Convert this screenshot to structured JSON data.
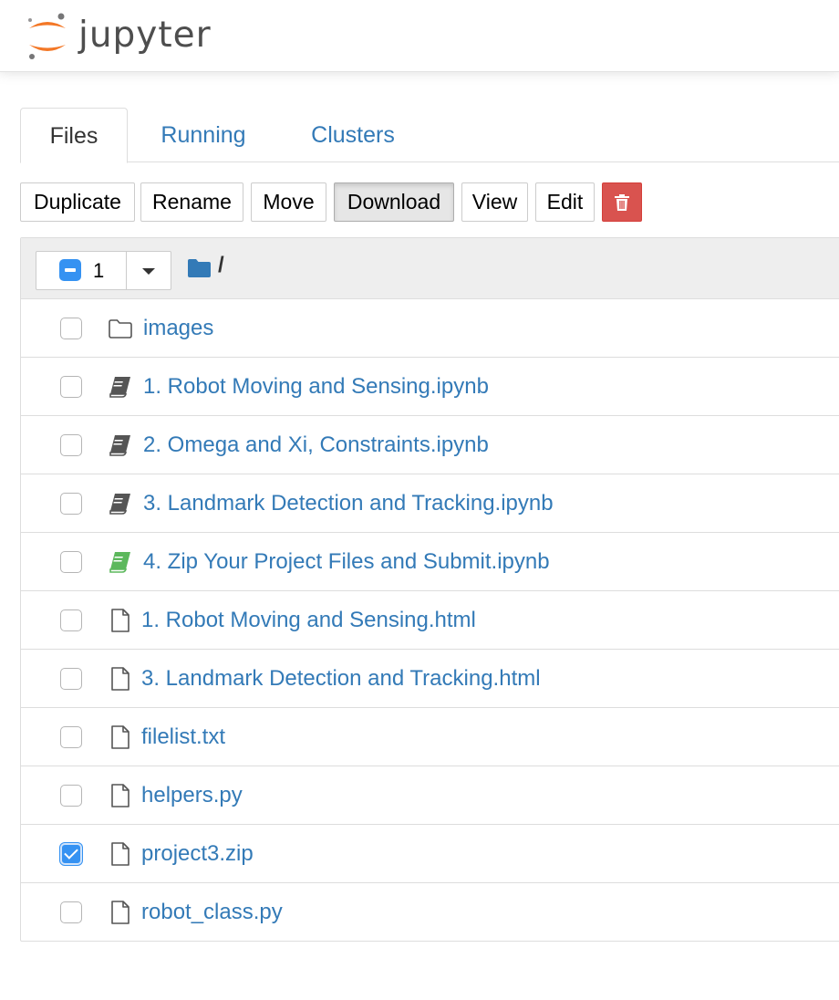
{
  "header": {
    "logo_text": "jupyter",
    "colors": {
      "logo_orange": "#f37726",
      "logo_gray": "#767677"
    }
  },
  "tabs": [
    {
      "label": "Files",
      "active": true
    },
    {
      "label": "Running",
      "active": false
    },
    {
      "label": "Clusters",
      "active": false
    }
  ],
  "toolbar": {
    "duplicate_label": "Duplicate",
    "rename_label": "Rename",
    "move_label": "Move",
    "download_label": "Download",
    "view_label": "View",
    "edit_label": "Edit",
    "delete_icon": "trash-icon",
    "colors": {
      "danger": "#d9534f"
    }
  },
  "list_header": {
    "selected_count": "1",
    "selection_state": "partial",
    "breadcrumb_icon": "folder-icon",
    "breadcrumb_path": "/"
  },
  "files": [
    {
      "name": "images",
      "type": "folder",
      "icon": "folder-icon",
      "checked": false
    },
    {
      "name": "1. Robot Moving and Sensing.ipynb",
      "type": "notebook",
      "icon": "notebook-icon",
      "running": false,
      "checked": false
    },
    {
      "name": "2. Omega and Xi, Constraints.ipynb",
      "type": "notebook",
      "icon": "notebook-icon",
      "running": false,
      "checked": false
    },
    {
      "name": "3. Landmark Detection and Tracking.ipynb",
      "type": "notebook",
      "icon": "notebook-icon",
      "running": false,
      "checked": false
    },
    {
      "name": "4. Zip Your Project Files and Submit.ipynb",
      "type": "notebook",
      "icon": "notebook-icon",
      "running": true,
      "checked": false
    },
    {
      "name": "1. Robot Moving and Sensing.html",
      "type": "file",
      "icon": "file-icon",
      "checked": false
    },
    {
      "name": "3. Landmark Detection and Tracking.html",
      "type": "file",
      "icon": "file-icon",
      "checked": false
    },
    {
      "name": "filelist.txt",
      "type": "file",
      "icon": "file-icon",
      "checked": false
    },
    {
      "name": "helpers.py",
      "type": "file",
      "icon": "file-icon",
      "checked": false
    },
    {
      "name": "project3.zip",
      "type": "file",
      "icon": "file-icon",
      "checked": true
    },
    {
      "name": "robot_class.py",
      "type": "file",
      "icon": "file-icon",
      "checked": false
    }
  ],
  "colors": {
    "link": "#337ab7",
    "checkbox_blue": "#3592f2",
    "running_notebook": "#5cb85c",
    "idle_notebook": "#555555"
  }
}
